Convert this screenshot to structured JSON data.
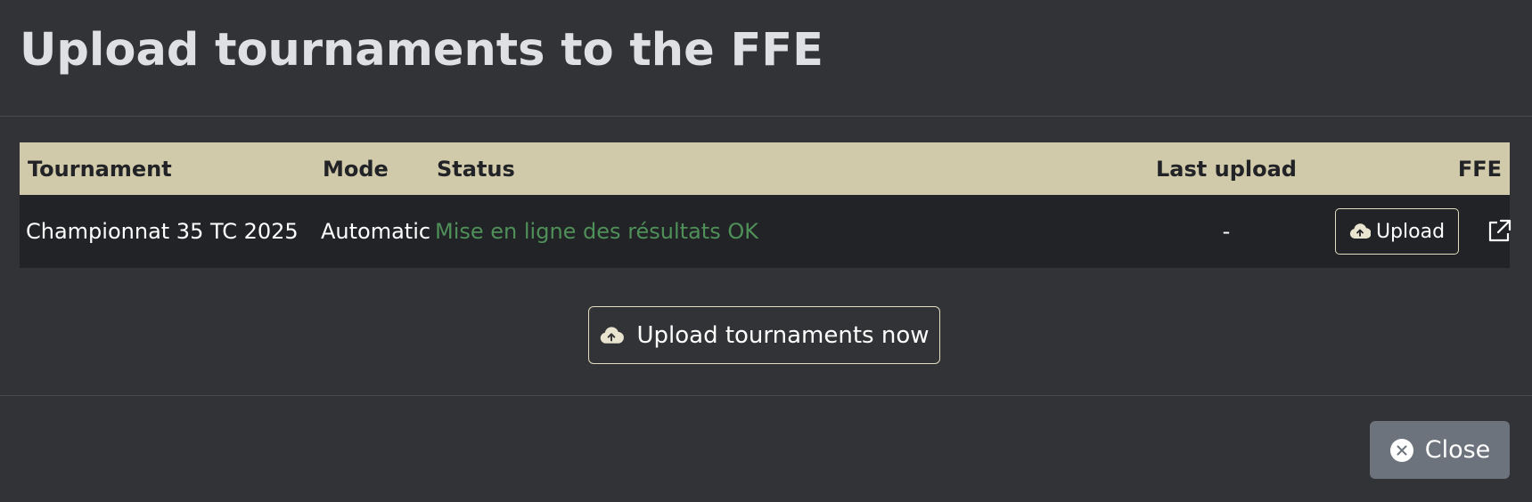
{
  "modal": {
    "title": "Upload tournaments to the FFE"
  },
  "table": {
    "headers": {
      "tournament": "Tournament",
      "mode": "Mode",
      "status": "Status",
      "last_upload": "Last upload",
      "ffe": "FFE"
    },
    "rows": [
      {
        "tournament": "Championnat 35 TC 2025",
        "mode": "Automatic",
        "status": "Mise en ligne des résultats OK",
        "last_upload": "-",
        "upload_label": "Upload",
        "upload_icon": "cloud-upload-icon",
        "ffe_icon": "external-link-icon"
      }
    ]
  },
  "actions": {
    "upload_all_label": "Upload tournaments now",
    "upload_all_icon": "cloud-upload-icon",
    "close_label": "Close",
    "close_icon": "close-circle-icon"
  },
  "colors": {
    "background": "#323336",
    "header_row": "#d0c9aa",
    "body_row": "#222327",
    "status_ok": "#4f8f58",
    "close_button": "#6d737c"
  }
}
